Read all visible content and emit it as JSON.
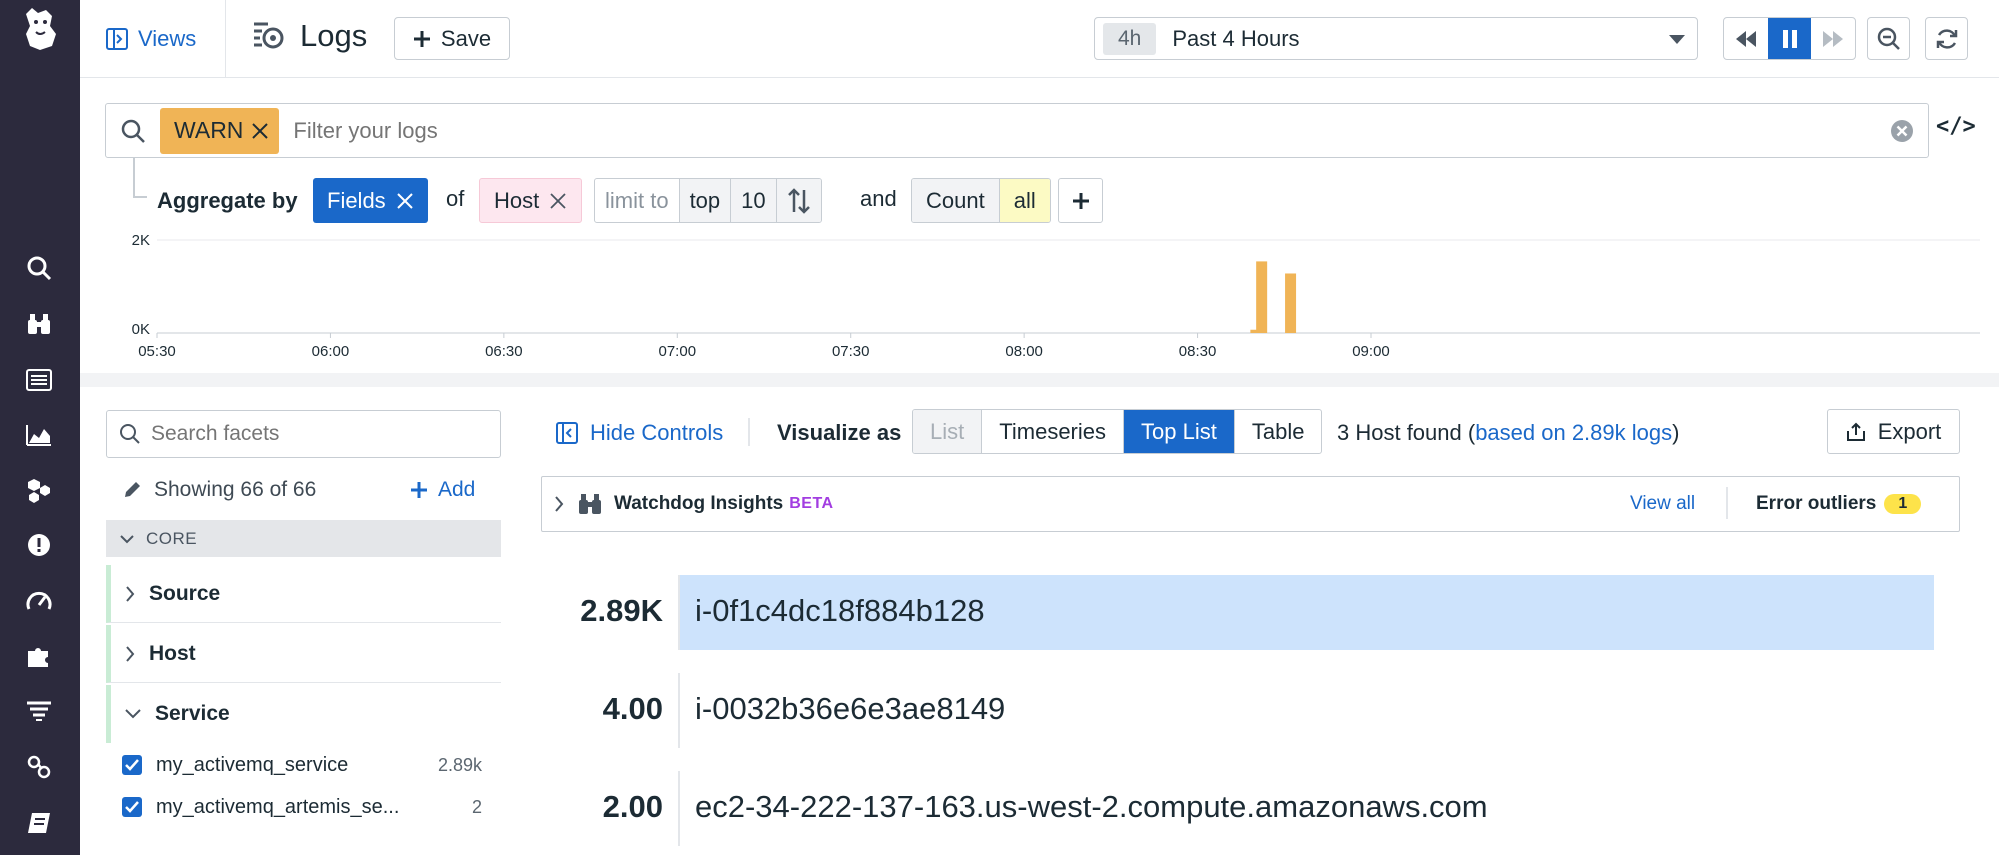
{
  "app": {
    "title": "Logs",
    "views_label": "Views",
    "save_label": "Save"
  },
  "time": {
    "badge": "4h",
    "label": "Past 4 Hours"
  },
  "query": {
    "chip": "WARN",
    "placeholder": "Filter your logs"
  },
  "aggregate": {
    "label": "Aggregate by",
    "fields_chip": "Fields",
    "of_label": "of",
    "host_chip": "Host",
    "limit_to": "limit to",
    "top": "top",
    "limit_n": "10",
    "and_label": "and",
    "count": "Count",
    "count_scope": "all"
  },
  "chart_data": {
    "type": "bar",
    "y_ticks": [
      "2K",
      "0K"
    ],
    "ylim": [
      0,
      2000
    ],
    "x_ticks": [
      "05:30",
      "06:00",
      "06:30",
      "07:00",
      "07:30",
      "08:00",
      "08:30",
      "09:00"
    ],
    "bars": [
      {
        "x": "08:40",
        "value": 70
      },
      {
        "x": "08:41",
        "value": 1540
      },
      {
        "x": "08:46",
        "value": 1280
      }
    ],
    "color": "#f0b456"
  },
  "facets": {
    "search_placeholder": "Search facets",
    "showing": "Showing 66 of 66",
    "add_label": "Add",
    "group": "CORE",
    "items": [
      {
        "label": "Source"
      },
      {
        "label": "Host"
      },
      {
        "label": "Service"
      }
    ],
    "service_values": [
      {
        "label": "my_activemq_service",
        "count": "2.89k"
      },
      {
        "label": "my_activemq_artemis_se...",
        "count": "2"
      }
    ]
  },
  "controls": {
    "hide_controls": "Hide Controls",
    "visualize_as": "Visualize as",
    "viz_options": [
      "List",
      "Timeseries",
      "Top List",
      "Table"
    ],
    "found_prefix": "3 Host found (",
    "found_link": "based on 2.89k logs",
    "found_suffix": ")",
    "export": "Export"
  },
  "watchdog": {
    "title": "Watchdog Insights",
    "beta": "BETA",
    "view_all": "View all",
    "errors_label": "Error outliers",
    "errors_count": "1"
  },
  "toplist": [
    {
      "value": "2.89K",
      "name": "i-0f1c4dc18f884b128",
      "fraction": 1.0
    },
    {
      "value": "4.00",
      "name": "i-0032b36e6e3ae8149",
      "fraction": 0.0014
    },
    {
      "value": "2.00",
      "name": "ec2-34-222-137-163.us-west-2.compute.amazonaws.com",
      "fraction": 0.0007
    }
  ],
  "colors": {
    "accent": "#1a68c9",
    "nav_bg": "#2c2a3d",
    "warn": "#f0b456",
    "highlight": "#cde3fc"
  }
}
